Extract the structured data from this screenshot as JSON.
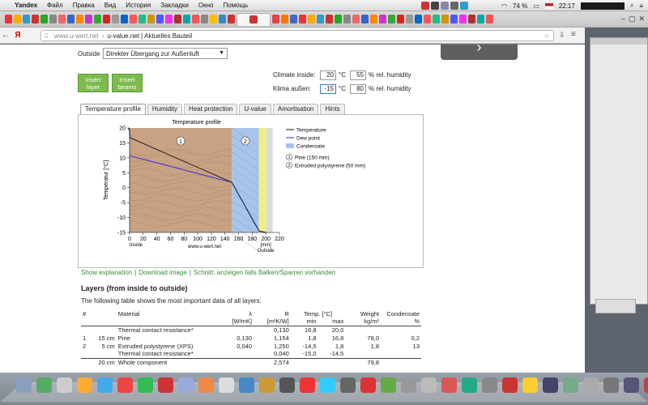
{
  "menubar": {
    "apple": "",
    "items": [
      "Yandex",
      "Файл",
      "Правка",
      "Вид",
      "История",
      "Закладки",
      "Окно",
      "Помощь"
    ],
    "battery": "74 %",
    "time": "22:17"
  },
  "browser": {
    "host": "www.u-wert.net",
    "separator": "›",
    "title": "u-value.net | Aktuelles Bauteil",
    "back": "←",
    "yandex": "Я"
  },
  "form": {
    "outside_label": "Outside",
    "outside_value": "Direkter Übergang zur Außenluft",
    "insert_layer": "Insert layer",
    "insert_beams": "Insert beams",
    "next_arrow": "›"
  },
  "climate": {
    "inside_label": "Climate inside:",
    "inside_temp": "20",
    "inside_unit": "°C",
    "inside_humidity": "55",
    "humidity_unit": "% rel. humidity",
    "outside_label": "Klima außen:",
    "outside_temp": "-15",
    "outside_unit": "°C",
    "outside_humidity": "80"
  },
  "tabs": [
    "Temperature profile",
    "Humidity",
    "Heat protection",
    "U-value",
    "Amortisation",
    "Hints"
  ],
  "chart_data": {
    "type": "line",
    "title": "Temperature profile",
    "ylabel": "Temperatur [°C]",
    "xlabel": "[mm]",
    "inside_label": "Inside",
    "outside_label": "Outside",
    "credit": "www.u-wert.net",
    "xlim": [
      0,
      220
    ],
    "ylim": [
      -15,
      20
    ],
    "xticks": [
      0,
      20,
      40,
      60,
      80,
      100,
      120,
      140,
      160,
      180,
      200,
      220
    ],
    "yticks": [
      20,
      15,
      10,
      5,
      0,
      -5,
      -10,
      -15
    ],
    "layers": [
      {
        "id": "1",
        "name": "Pine (150 mm)",
        "from": 0,
        "to": 150,
        "color": "#c8a283"
      },
      {
        "id": "2",
        "name": "Extruded polystyrene (50 mm)",
        "from": 150,
        "to": 190,
        "color": "#a9c4ea"
      }
    ],
    "series": [
      {
        "name": "Temperature",
        "color": "#111111",
        "x": [
          0,
          150,
          190,
          200
        ],
        "y": [
          16.8,
          1.8,
          -14.5,
          -15
        ]
      },
      {
        "name": "Dew point",
        "color": "#2a2ae0",
        "x": [
          0,
          150,
          190,
          200
        ],
        "y": [
          10.7,
          1.8,
          -14.5,
          -15
        ]
      }
    ],
    "legend": [
      "Temperature",
      "Dew point",
      "Condensate"
    ],
    "legend_layers": [
      "Pine (150 mm)",
      "Extruded polystyrene (50 mm)"
    ],
    "layer_markers": [
      "1",
      "2"
    ]
  },
  "links": {
    "explain": "Show explanation",
    "download": "Download image",
    "section": "Schnitt: anzeigen falls Balken/Sparren vorhanden",
    "sep": "|"
  },
  "layers_table": {
    "heading": "Layers (from inside to outside)",
    "intro": "The following table shows the most important data of all layers:",
    "header1": [
      "#",
      "Material",
      "λ",
      "R",
      "Temp. [°C]",
      "Weight",
      "Condensate"
    ],
    "header2": [
      "",
      "",
      "[W/mK]",
      "[m²K/W]",
      "min",
      "max",
      "kg/m²",
      "%"
    ],
    "rows": [
      [
        "",
        "",
        "Thermal contact resistance*",
        "",
        "0,130",
        "16,8",
        "20,0",
        "",
        ""
      ],
      [
        "1",
        "15 cm",
        "Pine",
        "0,130",
        "1,154",
        "1,8",
        "16,8",
        "78,0",
        "0,2"
      ],
      [
        "2",
        "5 cm",
        "Extruded polystyrene (XPS)",
        "0,040",
        "1,250",
        "-14,5",
        "1,8",
        "1,8",
        "13"
      ],
      [
        "",
        "",
        "Thermal contact resistance*",
        "",
        "0,040",
        "-15,0",
        "-14,5",
        "",
        ""
      ]
    ],
    "total": [
      "",
      "20 cm",
      "Whole component",
      "",
      "2,574",
      "",
      "",
      "79,8",
      ""
    ]
  }
}
